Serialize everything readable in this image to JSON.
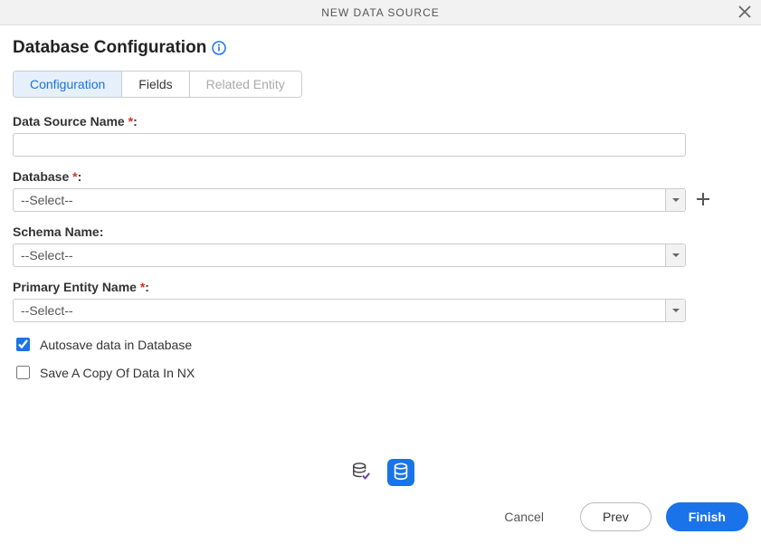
{
  "titlebar": {
    "title": "NEW DATA SOURCE"
  },
  "header": {
    "title": "Database Configuration"
  },
  "tabs": [
    {
      "label": "Configuration",
      "state": "active"
    },
    {
      "label": "Fields",
      "state": "enabled"
    },
    {
      "label": "Related Entity",
      "state": "disabled"
    }
  ],
  "fields": {
    "dataSourceName": {
      "label": "Data Source Name",
      "required": true,
      "value": ""
    },
    "database": {
      "label": "Database",
      "required": true,
      "selected": "--Select--"
    },
    "schemaName": {
      "label": "Schema Name",
      "required": false,
      "selected": "--Select--"
    },
    "primaryEntity": {
      "label": "Primary Entity Name",
      "required": true,
      "selected": "--Select--"
    }
  },
  "checkboxes": {
    "autosave": {
      "label": "Autosave data in Database",
      "checked": true
    },
    "saveCopy": {
      "label": "Save A Copy Of Data In NX",
      "checked": false
    }
  },
  "footer": {
    "cancel": "Cancel",
    "prev": "Prev",
    "finish": "Finish"
  },
  "misc": {
    "asterisk": " *",
    "colon": ":"
  }
}
